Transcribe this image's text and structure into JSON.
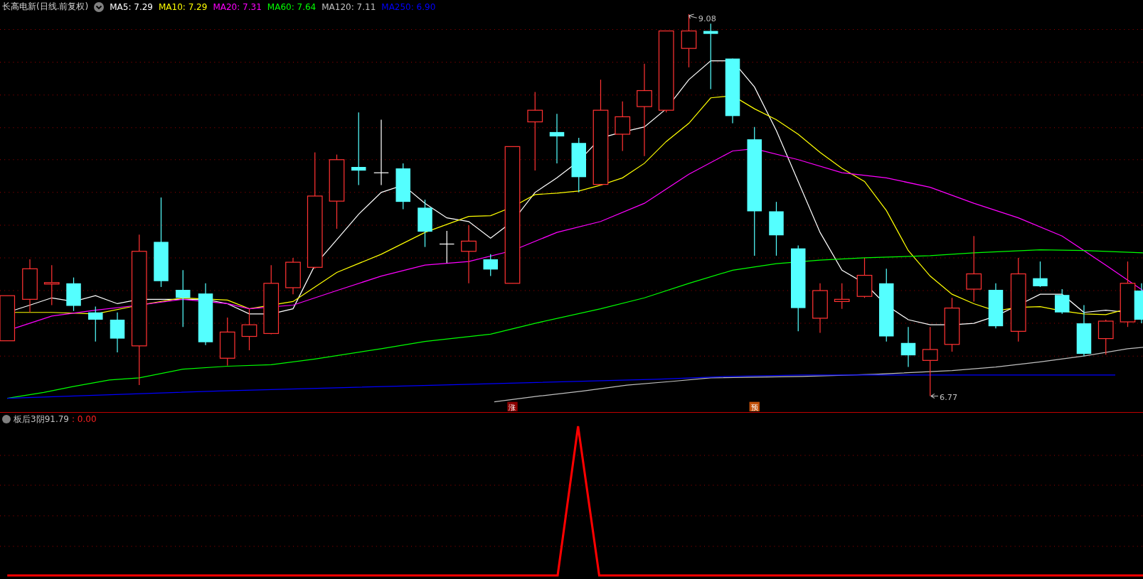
{
  "title": "长高电新(日线.前复权)",
  "ma_legend": [
    {
      "text": "MA5: 7.29",
      "color": "#ffffff"
    },
    {
      "text": "MA10: 7.29",
      "color": "#ffff00"
    },
    {
      "text": "MA20: 7.31",
      "color": "#ff00ff"
    },
    {
      "text": "MA60: 7.64",
      "color": "#00ff00"
    },
    {
      "text": "MA120: 7.11",
      "color": "#c0c0c0"
    },
    {
      "text": "MA250: 6.90",
      "color": "#0000ff"
    }
  ],
  "high_label": "9.08",
  "low_label": "6.77",
  "markers": [
    {
      "text": "涨",
      "color": "#8b0000"
    },
    {
      "text": "预",
      "color": "#c0500a"
    }
  ],
  "indicator": {
    "name": "板后3阴91.79",
    "reading": ": 0.00"
  }
}
